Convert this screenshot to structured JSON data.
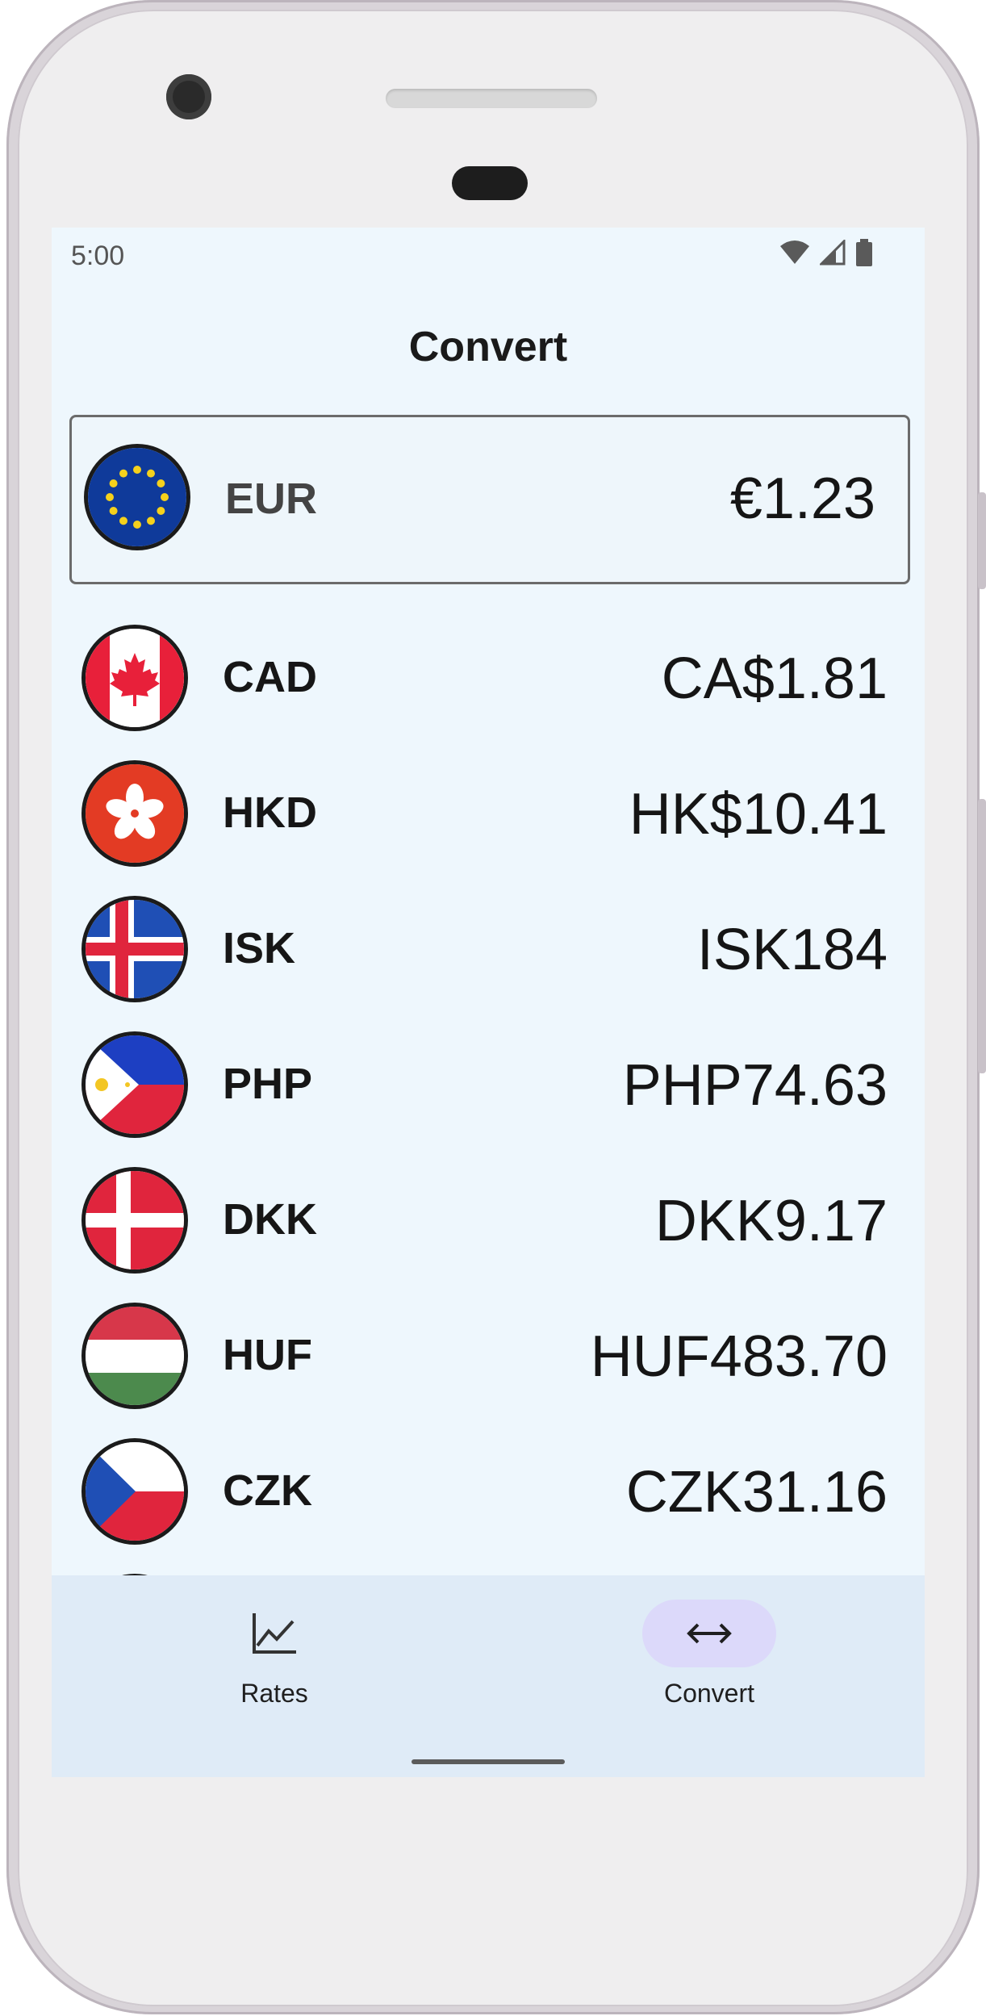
{
  "status_bar": {
    "time": "5:00",
    "icons": [
      "wifi-icon",
      "cell-signal-icon",
      "battery-icon"
    ]
  },
  "header": {
    "title": "Convert"
  },
  "selected_currency": {
    "code": "EUR",
    "amount": "€1.23",
    "flag": "eu-flag-icon"
  },
  "currencies": [
    {
      "code": "CAD",
      "amount": "CA$1.81",
      "flag": "canada-flag-icon"
    },
    {
      "code": "HKD",
      "amount": "HK$10.41",
      "flag": "hong-kong-flag-icon"
    },
    {
      "code": "ISK",
      "amount": "ISK184",
      "flag": "iceland-flag-icon"
    },
    {
      "code": "PHP",
      "amount": "PHP74.63",
      "flag": "philippines-flag-icon"
    },
    {
      "code": "DKK",
      "amount": "DKK9.17",
      "flag": "denmark-flag-icon"
    },
    {
      "code": "HUF",
      "amount": "HUF483.70",
      "flag": "hungary-flag-icon"
    },
    {
      "code": "CZK",
      "amount": "CZK31.16",
      "flag": "czech-flag-icon"
    }
  ],
  "bottom_nav": {
    "items": [
      {
        "label": "Rates",
        "icon": "line-chart-icon",
        "active": false
      },
      {
        "label": "Convert",
        "icon": "swap-horizontal-icon",
        "active": true
      }
    ]
  },
  "colors": {
    "screen_background": "#eef7fd",
    "nav_background": "#dfebf7",
    "active_pill": "#dcd9fa"
  }
}
